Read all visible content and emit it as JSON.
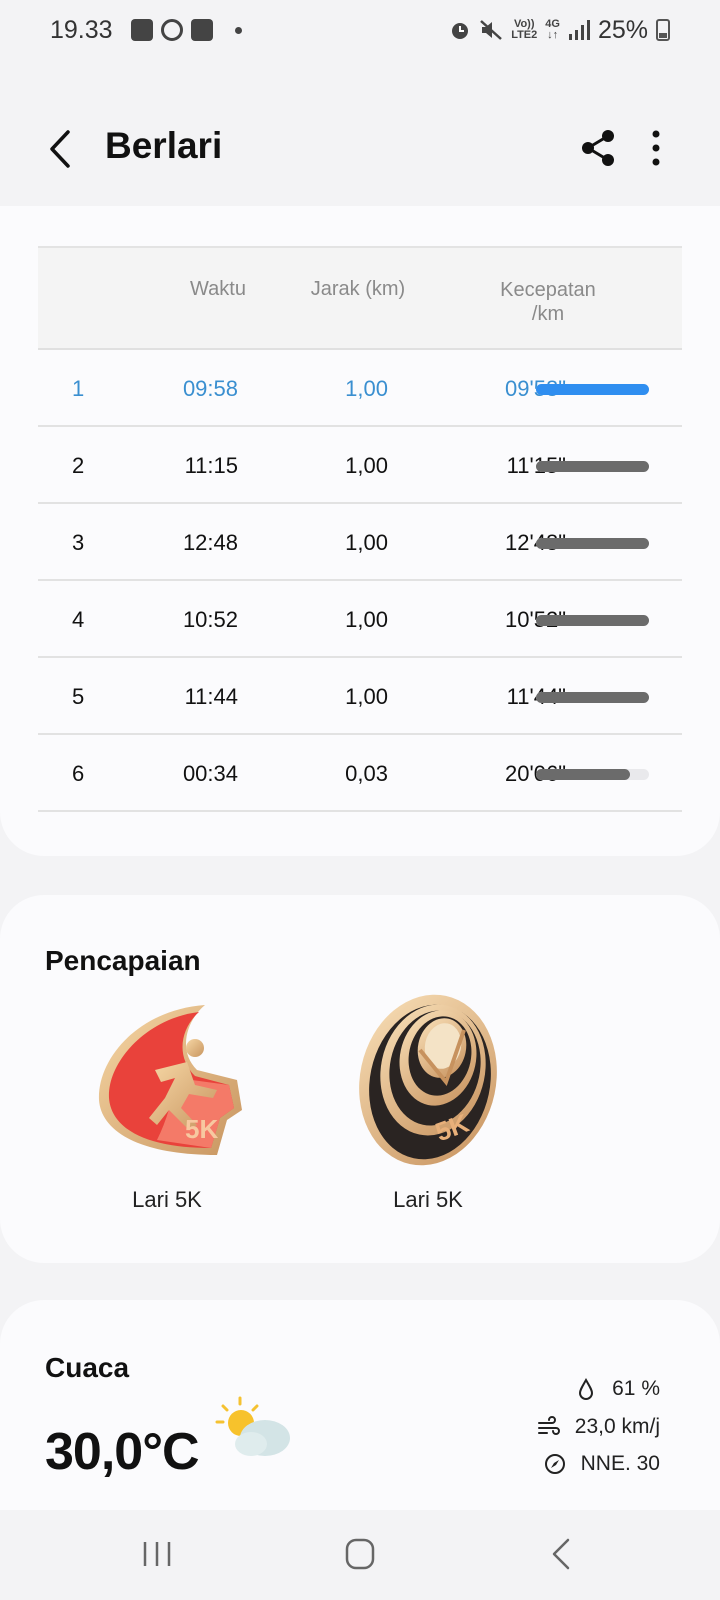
{
  "status_bar": {
    "time": "19.33",
    "network_label_top": "Vo))",
    "network_label_bottom": "LTE2",
    "data_label": "4G",
    "battery": "25%"
  },
  "app_bar": {
    "title": "Berlari"
  },
  "splits": {
    "headers": {
      "time": "Waktu",
      "distance": "Jarak (km)",
      "pace_line1": "Kecepatan",
      "pace_line2": "/km"
    },
    "rows": [
      {
        "lap": "1",
        "time": "09:58",
        "distance": "1,00",
        "pace": "09'58\"",
        "bar_fraction": 1.0
      },
      {
        "lap": "2",
        "time": "11:15",
        "distance": "1,00",
        "pace": "11'15\"",
        "bar_fraction": 1.0
      },
      {
        "lap": "3",
        "time": "12:48",
        "distance": "1,00",
        "pace": "12'48\"",
        "bar_fraction": 1.0
      },
      {
        "lap": "4",
        "time": "10:52",
        "distance": "1,00",
        "pace": "10'52\"",
        "bar_fraction": 1.0
      },
      {
        "lap": "5",
        "time": "11:44",
        "distance": "1,00",
        "pace": "11'44\"",
        "bar_fraction": 1.0
      },
      {
        "lap": "6",
        "time": "00:34",
        "distance": "0,03",
        "pace": "20'06\"",
        "bar_fraction": 0.83
      }
    ],
    "highlight_color": "#2f8ef0"
  },
  "achievements": {
    "title": "Pencapaian",
    "badges": [
      {
        "label": "Lari 5K",
        "badge_text": "5K",
        "icon": "running-5k-badge-icon"
      },
      {
        "label": "Lari 5K",
        "badge_text": "5K",
        "icon": "spiral-5k-badge-icon"
      }
    ]
  },
  "weather": {
    "title": "Cuaca",
    "temperature": "30,0°C",
    "humidity": "61 %",
    "wind_speed": "23,0 km/j",
    "wind_direction": "NNE. 30",
    "condition_icon": "partly-cloudy-icon"
  }
}
